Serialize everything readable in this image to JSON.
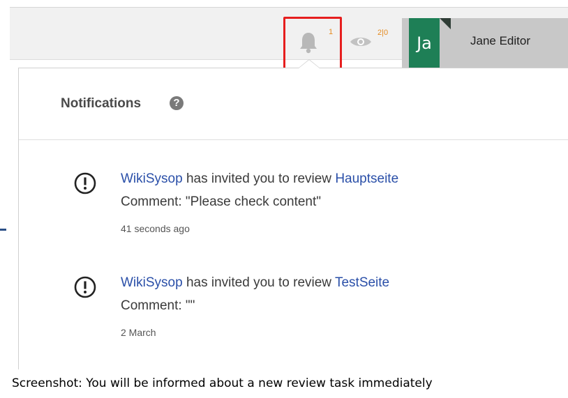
{
  "topbar": {
    "notification_count": "1",
    "watch_count": "2|0",
    "avatar_initials": "Ja",
    "user_name": "Jane Editor",
    "count_color": "#e58a1f",
    "avatar_color": "#1e7f56"
  },
  "notifications_panel": {
    "title": "Notifications",
    "items": [
      {
        "icon": "alert-circle-icon",
        "actor": "WikiSysop",
        "action": " has invited you to review ",
        "page": "Hauptseite",
        "comment": "Comment: \"Please check content\"",
        "time": "41 seconds ago"
      },
      {
        "icon": "alert-circle-icon",
        "actor": "WikiSysop",
        "action": " has invited you to review ",
        "page": "TestSeite",
        "comment": "Comment: \"\"",
        "time": "2 March"
      }
    ]
  },
  "caption": "Screenshot: You will be informed about a new review task immediately",
  "colors": {
    "link": "#2a4fa8",
    "highlight": "#e61e1e"
  }
}
